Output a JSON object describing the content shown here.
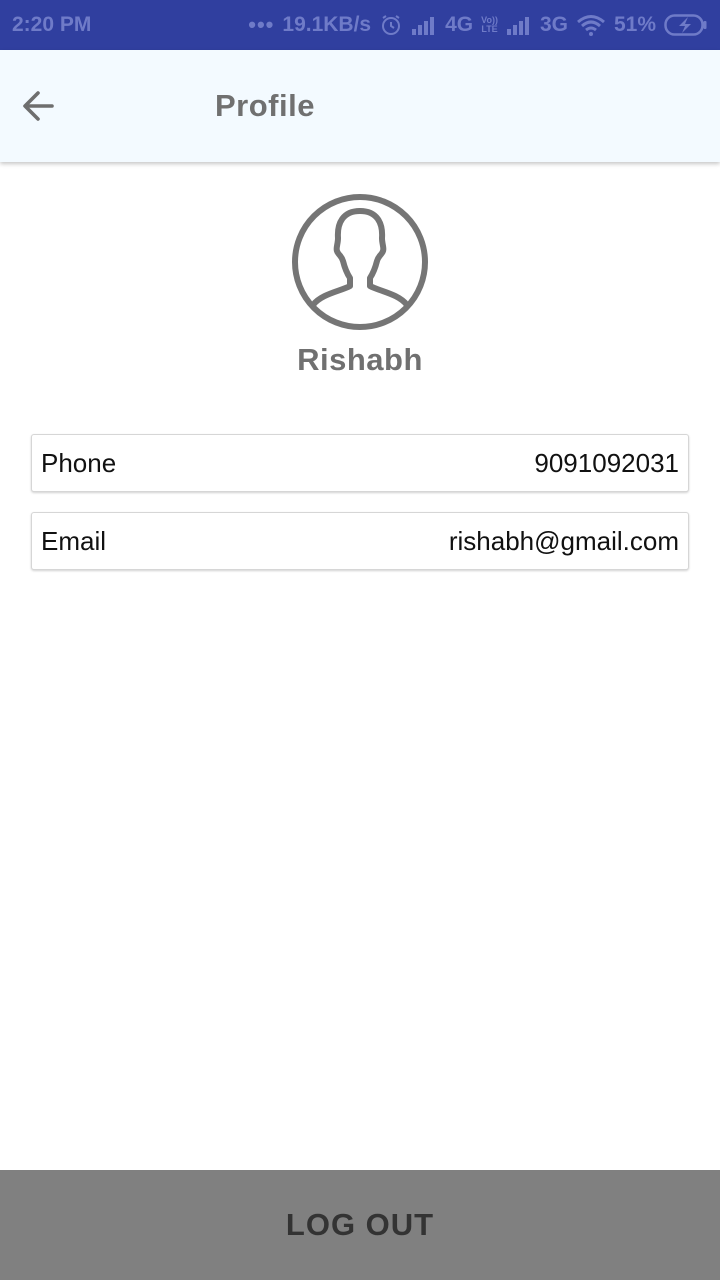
{
  "status_bar": {
    "time": "2:20 PM",
    "dots": "•••",
    "net_speed": "19.1KB/s",
    "network_1": "4G",
    "volte_top": "Vo))",
    "volte_bottom": "LTE",
    "network_2": "3G",
    "battery": "51%",
    "icons": [
      "alarm-icon",
      "signal-icon",
      "wifi-icon",
      "battery-charging-icon"
    ]
  },
  "header": {
    "title": "Profile",
    "back_icon": "arrow-left-icon"
  },
  "profile": {
    "avatar_icon": "user-avatar-icon",
    "name": "Rishabh"
  },
  "fields": {
    "phone": {
      "label": "Phone",
      "value": "9091092031"
    },
    "email": {
      "label": "Email",
      "value": "rishabh@gmail.com"
    }
  },
  "actions": {
    "logout_label": "LOG OUT"
  },
  "colors": {
    "status_bar": "#303f9f",
    "app_bar": "#f3faff",
    "title_text": "#707070",
    "logout_bg": "#808080",
    "logout_text": "#333333"
  }
}
